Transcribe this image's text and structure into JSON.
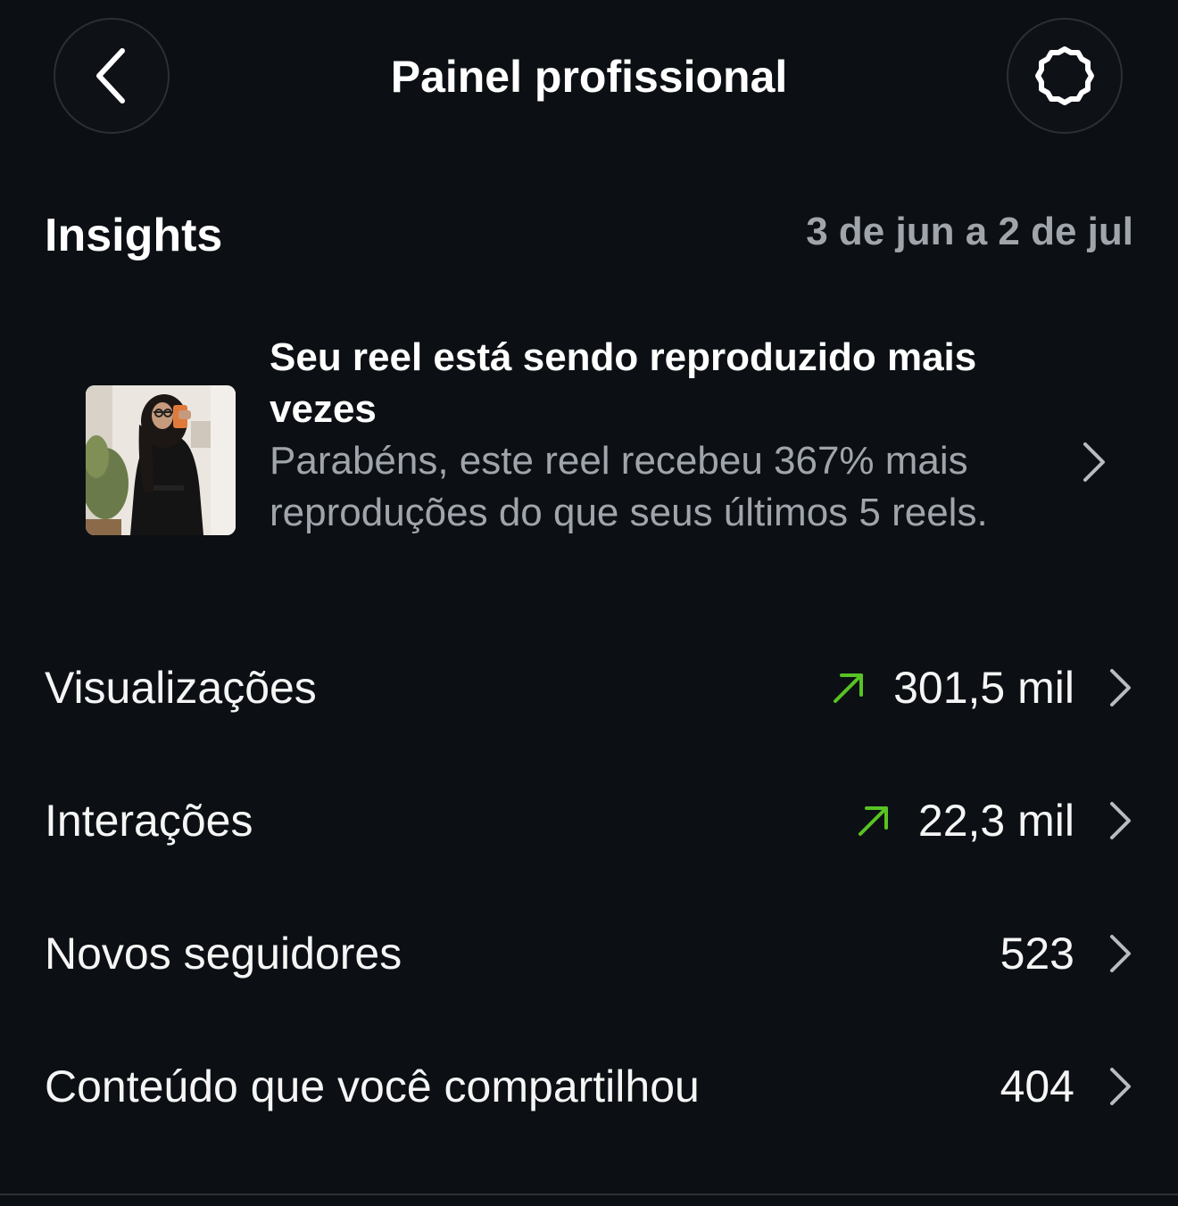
{
  "header": {
    "title": "Painel profissional",
    "back_icon": "chevron-left-icon",
    "settings_icon": "gear-icon"
  },
  "insights": {
    "title": "Insights",
    "date_range": "3 de jun a 2 de jul"
  },
  "highlight_card": {
    "title": "Seu reel está sendo reproduzido mais vezes",
    "description": "Parabéns, este reel recebeu 367% mais reproduções do que seus últimos 5 reels."
  },
  "metrics": [
    {
      "label": "Visualizações",
      "value": "301,5 mil",
      "trend": "up"
    },
    {
      "label": "Interações",
      "value": "22,3 mil",
      "trend": "up"
    },
    {
      "label": "Novos seguidores",
      "value": "523",
      "trend": "none"
    },
    {
      "label": "Conteúdo que você compartilhou",
      "value": "404",
      "trend": "none"
    }
  ],
  "colors": {
    "background": "#0c1014",
    "trend_up": "#58c322",
    "secondary_text": "#a0a5ac"
  }
}
